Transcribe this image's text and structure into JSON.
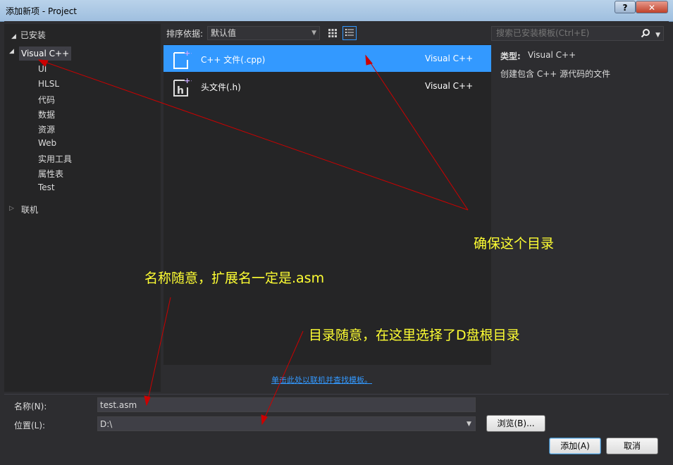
{
  "window": {
    "title": "添加新项 - Project",
    "help": "?",
    "close": "✕"
  },
  "left": {
    "installed": "已安装",
    "root": "Visual C++",
    "items": [
      "UI",
      "HLSL",
      "代码",
      "数据",
      "资源",
      "Web",
      "实用工具",
      "属性表",
      "Test"
    ],
    "online": "联机"
  },
  "toolbar": {
    "sort_label": "排序依据:",
    "sort_value": "默认值",
    "search_placeholder": "搜索已安装模板(Ctrl+E)"
  },
  "templates": [
    {
      "name": "C++ 文件(.cpp)",
      "lang": "Visual C++"
    },
    {
      "name": "头文件(.h)",
      "lang": "Visual C++"
    }
  ],
  "info": {
    "type_label": "类型:",
    "type_value": "Visual C++",
    "description": "创建包含 C++ 源代码的文件"
  },
  "online_link": "单击此处以联机并查找模板。",
  "form": {
    "name_label": "名称(N):",
    "name_value": "test.asm",
    "location_label": "位置(L):",
    "location_value": "D:\\",
    "browse": "浏览(B)...",
    "add": "添加(A)",
    "cancel": "取消"
  },
  "annotations": {
    "ensure_dir": "确保这个目录",
    "name_note": "名称随意，扩展名一定是.asm",
    "dir_note": "目录随意，在这里选择了D盘根目录"
  },
  "colors": {
    "accent": "#3399ff",
    "annotation": "#ffff33",
    "arrow": "#cc0000"
  }
}
